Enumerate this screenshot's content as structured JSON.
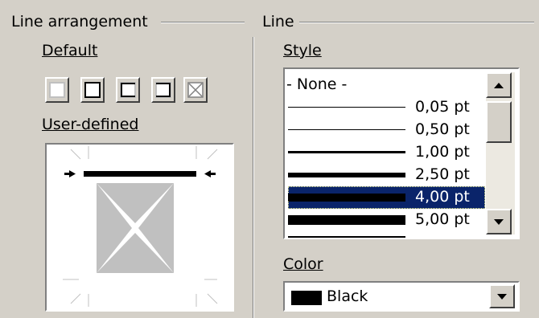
{
  "line_arrangement": {
    "group_title": "Line arrangement",
    "default_label": "Default",
    "user_defined_label": "User-defined",
    "presets": [
      {
        "name": "no-borders",
        "icon": "border-none-icon"
      },
      {
        "name": "outer-border-only",
        "icon": "border-outer-icon"
      },
      {
        "name": "outer-border-horizontal",
        "icon": "border-outer-horizontal-icon"
      },
      {
        "name": "outer-border-vertical",
        "icon": "border-outer-vertical-icon"
      },
      {
        "name": "outer-border-diagonal",
        "icon": "border-diagonal-icon"
      }
    ]
  },
  "line": {
    "group_title": "Line",
    "style_label": "Style",
    "style_options": [
      {
        "label": "- None -",
        "weight": 0
      },
      {
        "label": "0,05 pt",
        "weight": 0.05
      },
      {
        "label": "0,50 pt",
        "weight": 0.5
      },
      {
        "label": "1,00 pt",
        "weight": 1.0
      },
      {
        "label": "2,50 pt",
        "weight": 2.5
      },
      {
        "label": "4,00 pt",
        "weight": 4.0
      },
      {
        "label": "5,00 pt",
        "weight": 5.0
      }
    ],
    "selected_style": "4,00 pt",
    "color_label": "Color",
    "color_value": "Black",
    "color_swatch": "#000000"
  },
  "colors": {
    "background": "#d4d0c8",
    "selection": "#0a246a",
    "shadow": "#808080",
    "preview_fill": "#c0c0c0"
  }
}
